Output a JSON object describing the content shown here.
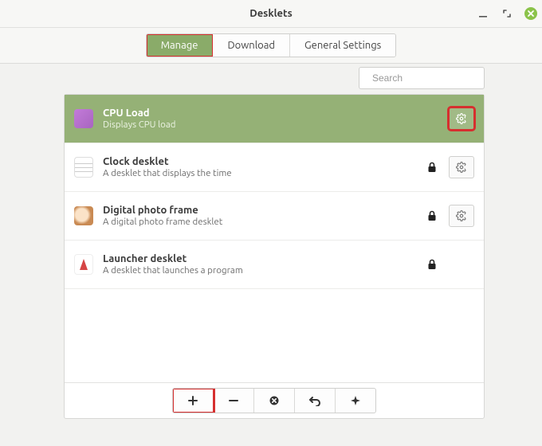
{
  "window": {
    "title": "Desklets"
  },
  "tabs": {
    "manage": "Manage",
    "download": "Download",
    "general_settings": "General Settings",
    "active_index": 0
  },
  "search": {
    "placeholder": "Search",
    "value": ""
  },
  "desklets": [
    {
      "id": "cpu-load",
      "title": "CPU Load",
      "description": "Displays CPU load",
      "locked": false,
      "has_settings": true,
      "selected": true,
      "icon": "cpu"
    },
    {
      "id": "clock",
      "title": "Clock desklet",
      "description": "A desklet that displays the time",
      "locked": true,
      "has_settings": true,
      "selected": false,
      "icon": "clock"
    },
    {
      "id": "photo-frame",
      "title": "Digital photo frame",
      "description": "A digital photo frame desklet",
      "locked": true,
      "has_settings": true,
      "selected": false,
      "icon": "photo"
    },
    {
      "id": "launcher",
      "title": "Launcher desklet",
      "description": "A desklet that launches a program",
      "locked": true,
      "has_settings": false,
      "selected": false,
      "icon": "launcher"
    }
  ],
  "highlights": {
    "tab_manage": true,
    "row_cpu_gear": true,
    "add_button": true
  },
  "colors": {
    "accent": "#8aab69",
    "highlight": "#d62f2f"
  }
}
